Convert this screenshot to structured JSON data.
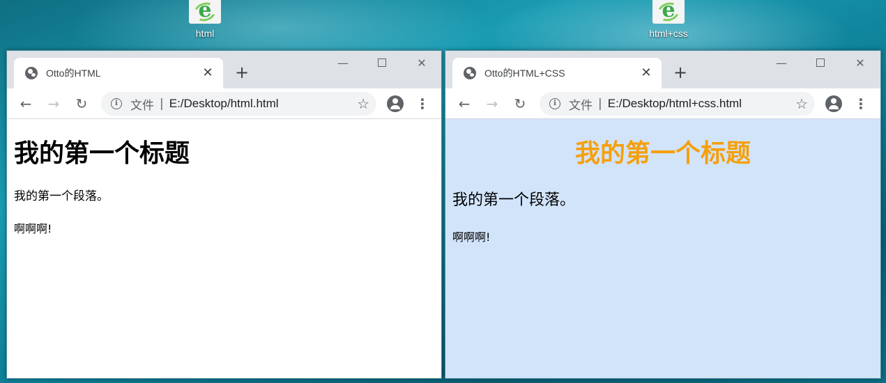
{
  "desktop": {
    "icons": [
      {
        "label": "html"
      },
      {
        "label": "html+css"
      }
    ]
  },
  "windows": [
    {
      "tab_title": "Otto的HTML",
      "tab_close": "✕",
      "new_tab": "+",
      "address_scheme": "文件",
      "address_separator": "|",
      "address_url": "E:/Desktop/html.html",
      "page": {
        "heading": "我的第一个标题",
        "paragraph1": "我的第一个段落。",
        "paragraph2": "啊啊啊!"
      },
      "page_background": "#ffffff"
    },
    {
      "tab_title": "Otto的HTML+CSS",
      "tab_close": "✕",
      "new_tab": "+",
      "address_scheme": "文件",
      "address_separator": "|",
      "address_url": "E:/Desktop/html+css.html",
      "page": {
        "heading": "我的第一个标题",
        "paragraph1": "我的第一个段落。",
        "paragraph2": "啊啊啊!"
      },
      "page_background": "#d2e4fa",
      "heading_color": "#f5a00d"
    }
  ],
  "icons": {
    "back": "back-arrow-icon",
    "forward": "forward-arrow-icon",
    "reload": "reload-icon",
    "info": "info-icon",
    "star": "bookmark-star-icon",
    "account": "account-icon",
    "menu": "kebab-menu-icon",
    "globe": "globe-icon",
    "minimize": "minimize-icon",
    "maximize": "maximize-icon",
    "close": "close-icon"
  }
}
